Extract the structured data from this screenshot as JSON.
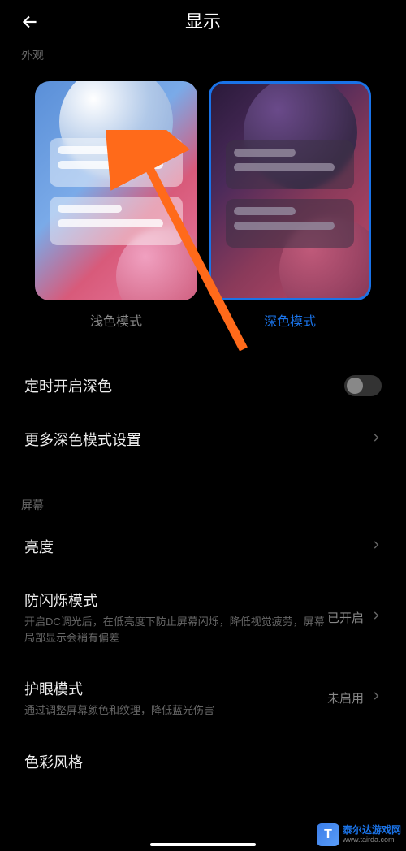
{
  "header": {
    "title": "显示"
  },
  "appearance": {
    "section_label": "外观",
    "light_label": "浅色模式",
    "dark_label": "深色模式"
  },
  "settings": {
    "scheduled_dark": {
      "title": "定时开启深色",
      "enabled": false
    },
    "more_dark": {
      "title": "更多深色模式设置"
    }
  },
  "screen": {
    "section_label": "屏幕",
    "brightness": {
      "title": "亮度"
    },
    "anti_flicker": {
      "title": "防闪烁模式",
      "subtitle": "开启DC调光后，在低亮度下防止屏幕闪烁，降低视觉疲劳，屏幕局部显示会稍有偏差",
      "status": "已开启"
    },
    "eye_care": {
      "title": "护眼模式",
      "subtitle": "通过调整屏幕颜色和纹理，降低蓝光伤害",
      "status": "未启用"
    },
    "color_style": {
      "title": "色彩风格"
    }
  },
  "watermark": {
    "name": "泰尔达游戏网",
    "url": "www.tairda.com"
  },
  "colors": {
    "accent": "#1a73e8",
    "arrow": "#ff6a1a"
  }
}
